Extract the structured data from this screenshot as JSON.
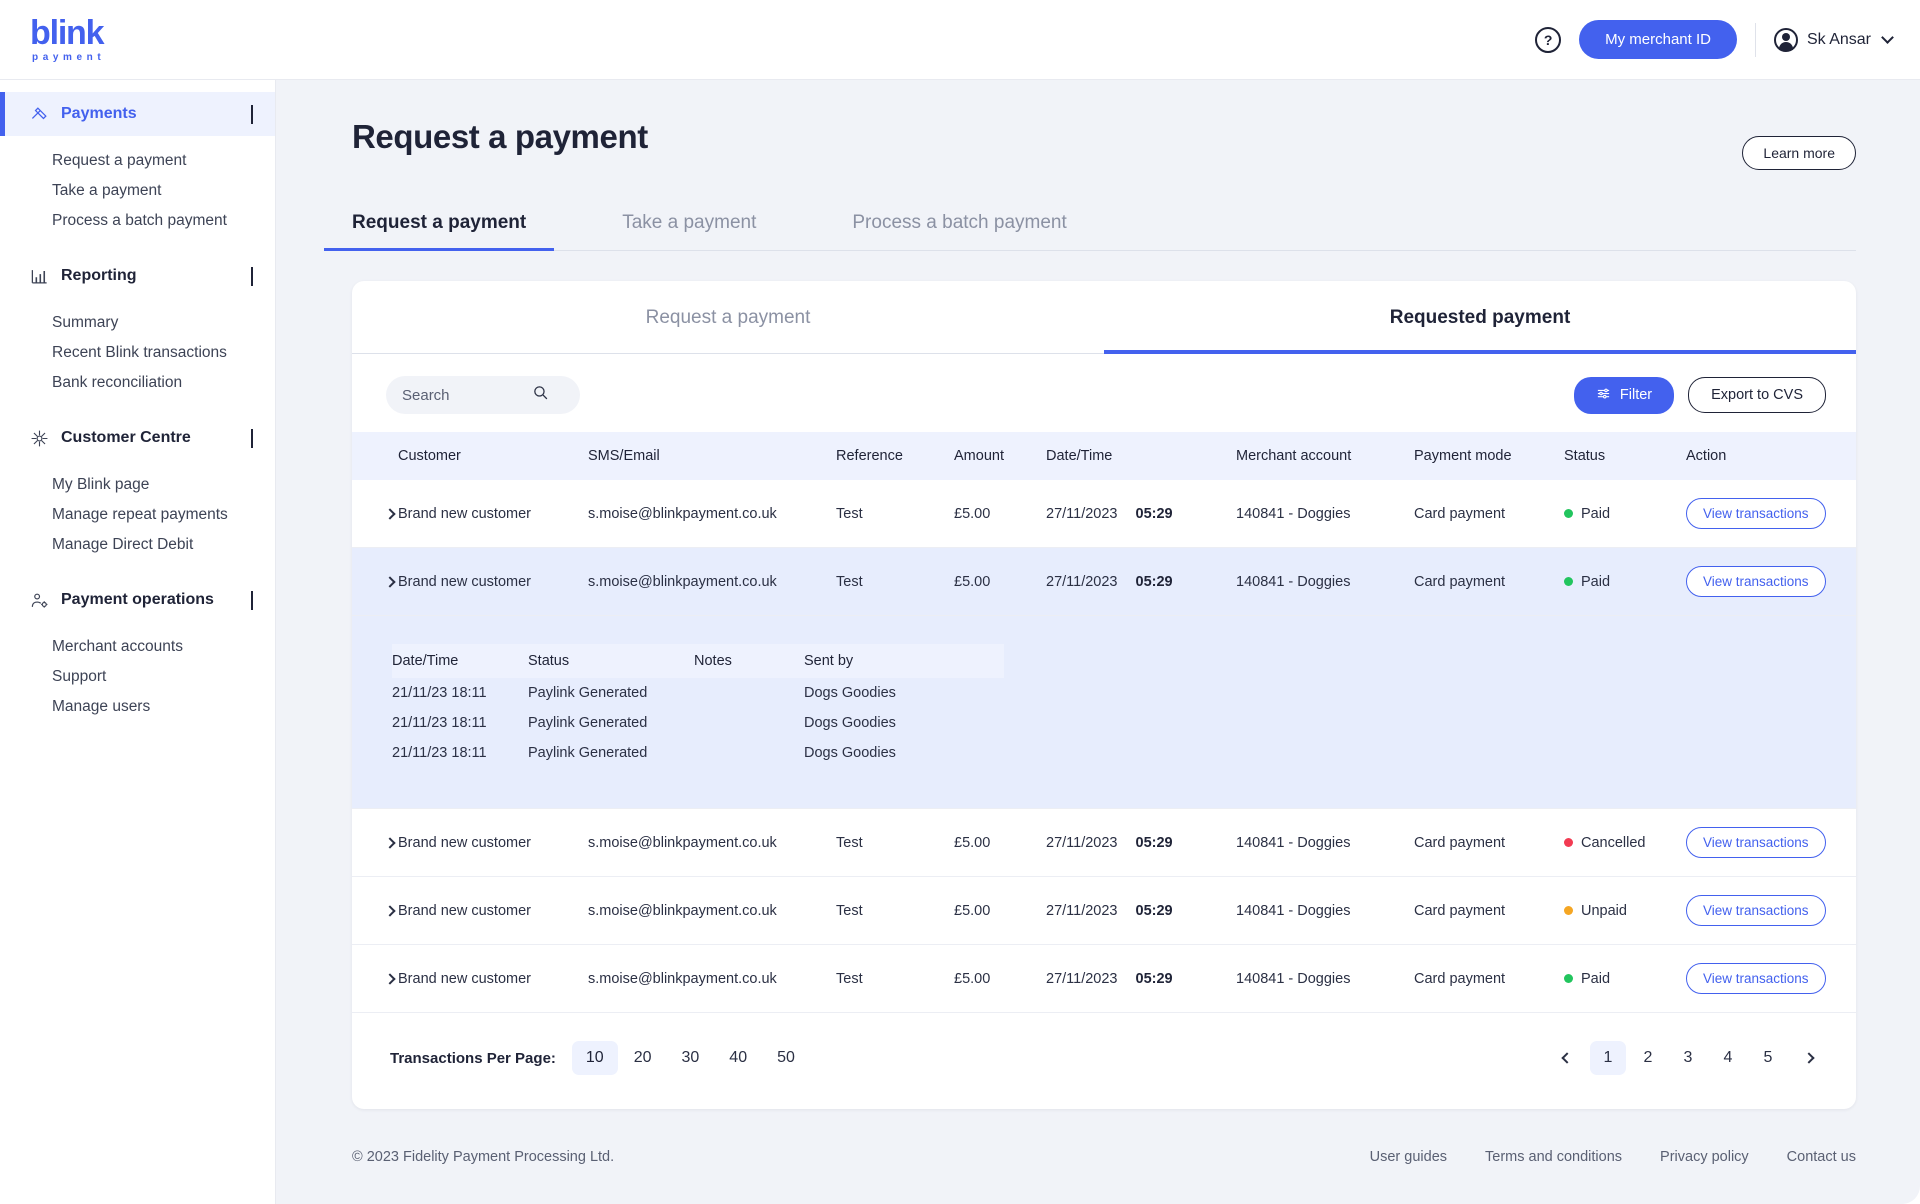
{
  "brand": {
    "name": "blink",
    "tagline": "payment",
    "color": "#4361ee"
  },
  "header": {
    "help_icon": "question-mark-icon",
    "merchant_button": "My merchant ID",
    "user_name": "Sk Ansar"
  },
  "sidebar": {
    "groups": [
      {
        "label": "Payments",
        "icon": "payments-icon",
        "active": true,
        "chevron": "right",
        "items": [
          "Request a payment",
          "Take a payment",
          "Process a batch payment"
        ]
      },
      {
        "label": "Reporting",
        "icon": "reporting-chart-icon",
        "active": false,
        "chevron": "down",
        "items": [
          "Summary",
          "Recent Blink transactions",
          "Bank reconciliation"
        ]
      },
      {
        "label": "Customer Centre",
        "icon": "customer-centre-icon",
        "active": false,
        "chevron": "down",
        "items": [
          "My Blink page",
          "Manage repeat payments",
          "Manage Direct Debit"
        ]
      },
      {
        "label": "Payment operations",
        "icon": "payment-operations-icon",
        "active": false,
        "chevron": "down",
        "items": [
          "Merchant accounts",
          "Support",
          "Manage users"
        ]
      }
    ]
  },
  "page": {
    "title": "Request a payment",
    "learn_more": "Learn more",
    "top_tabs": [
      {
        "label": "Request a payment",
        "active": true
      },
      {
        "label": "Take a payment",
        "active": false
      },
      {
        "label": "Process a batch payment",
        "active": false
      }
    ],
    "inner_tabs": [
      {
        "label": "Request a payment",
        "active": false
      },
      {
        "label": "Requested payment",
        "active": true
      }
    ]
  },
  "toolbar": {
    "search_placeholder": "Search",
    "search_value": "",
    "search_icon": "search-icon",
    "filter_label": "Filter",
    "filter_icon": "filter-sliders-icon",
    "export_label": "Export to CVS"
  },
  "table": {
    "headers": {
      "customer": "Customer",
      "email": "SMS/Email",
      "reference": "Reference",
      "amount": "Amount",
      "datetime": "Date/Time",
      "merchant": "Merchant account",
      "mode": "Payment mode",
      "status": "Status",
      "action": "Action"
    },
    "action_label": "View transactions",
    "status_colors": {
      "Paid": "#22c55e",
      "Cancelled": "#f23b52",
      "Unpaid": "#f5a623"
    },
    "rows": [
      {
        "customer": "Brand new customer",
        "email": "s.moise@blinkpayment.co.uk",
        "reference": "Test",
        "amount": "£5.00",
        "date": "27/11/2023",
        "time": "05:29",
        "merchant": "140841 - Doggies",
        "mode": "Card payment",
        "status": "Paid",
        "expanded": false
      },
      {
        "customer": "Brand new customer",
        "email": "s.moise@blinkpayment.co.uk",
        "reference": "Test",
        "amount": "£5.00",
        "date": "27/11/2023",
        "time": "05:29",
        "merchant": "140841 - Doggies",
        "mode": "Card payment",
        "status": "Paid",
        "expanded": true
      },
      {
        "customer": "Brand new customer",
        "email": "s.moise@blinkpayment.co.uk",
        "reference": "Test",
        "amount": "£5.00",
        "date": "27/11/2023",
        "time": "05:29",
        "merchant": "140841 - Doggies",
        "mode": "Card payment",
        "status": "Cancelled",
        "expanded": false
      },
      {
        "customer": "Brand new customer",
        "email": "s.moise@blinkpayment.co.uk",
        "reference": "Test",
        "amount": "£5.00",
        "date": "27/11/2023",
        "time": "05:29",
        "merchant": "140841 - Doggies",
        "mode": "Card payment",
        "status": "Unpaid",
        "expanded": false
      },
      {
        "customer": "Brand new customer",
        "email": "s.moise@blinkpayment.co.uk",
        "reference": "Test",
        "amount": "£5.00",
        "date": "27/11/2023",
        "time": "05:29",
        "merchant": "140841 - Doggies",
        "mode": "Card payment",
        "status": "Paid",
        "expanded": false
      }
    ],
    "detail": {
      "headers": {
        "datetime": "Date/Time",
        "status": "Status",
        "notes": "Notes",
        "sent_by": "Sent by"
      },
      "rows": [
        {
          "datetime": "21/11/23 18:11",
          "status": "Paylink Generated",
          "notes": "",
          "sent_by": "Dogs Goodies"
        },
        {
          "datetime": "21/11/23 18:11",
          "status": "Paylink Generated",
          "notes": "",
          "sent_by": "Dogs Goodies"
        },
        {
          "datetime": "21/11/23 18:11",
          "status": "Paylink Generated",
          "notes": "",
          "sent_by": "Dogs Goodies"
        }
      ]
    }
  },
  "pagination": {
    "per_page_label": "Transactions Per Page:",
    "per_page_options": [
      "10",
      "20",
      "30",
      "40",
      "50"
    ],
    "per_page_selected": "10",
    "pages": [
      "1",
      "2",
      "3",
      "4",
      "5"
    ],
    "current_page": "1"
  },
  "footer": {
    "copyright": "© 2023 Fidelity Payment Processing Ltd.",
    "links": [
      "User guides",
      "Terms and conditions",
      "Privacy policy",
      "Contact us"
    ]
  }
}
